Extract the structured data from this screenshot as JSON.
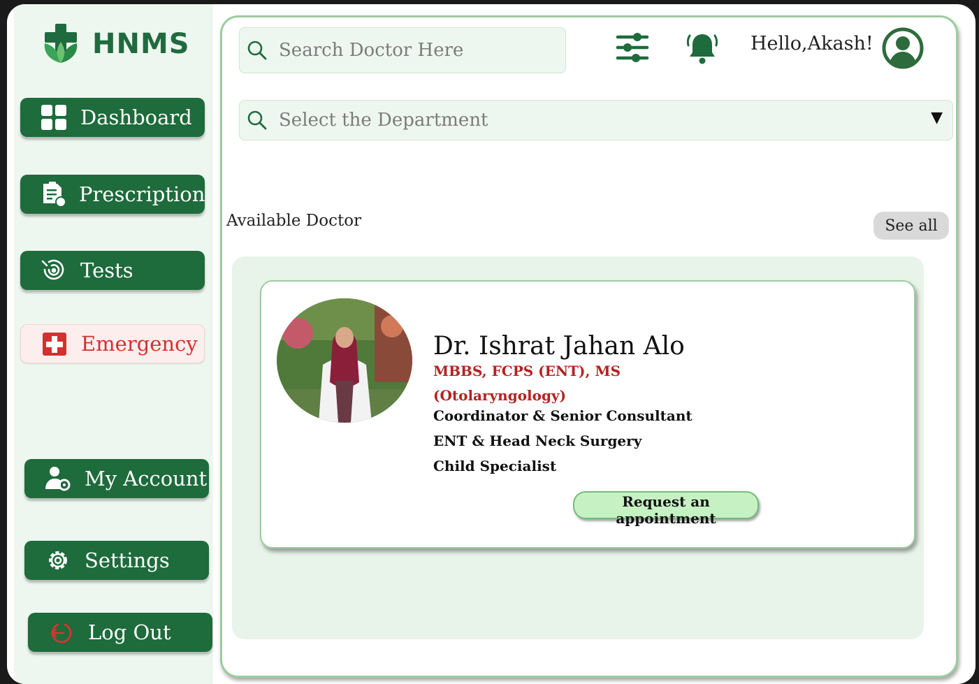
{
  "brand": {
    "name": "HNMS"
  },
  "sidebar": {
    "items": [
      {
        "label": "Dashboard",
        "icon": "grid-icon"
      },
      {
        "label": "Prescription",
        "icon": "prescription-icon"
      },
      {
        "label": "Tests",
        "icon": "tests-icon"
      },
      {
        "label": "Emergency",
        "icon": "emergency-kit-icon"
      },
      {
        "label": "My Account",
        "icon": "user-gear-icon"
      },
      {
        "label": "Settings",
        "icon": "gear-icon"
      },
      {
        "label": "Log Out",
        "icon": "logout-icon"
      }
    ]
  },
  "header": {
    "search_placeholder": "Search Doctor Here",
    "greeting": "Hello,Akash!"
  },
  "department": {
    "placeholder": "Select the Department"
  },
  "available": {
    "title": "Available Doctor",
    "see_all": "See all"
  },
  "doctor": {
    "name": "Dr. Ishrat Jahan Alo",
    "degrees_line1": "MBBS, FCPS (ENT), MS",
    "degrees_line2": "(Otolaryngology)",
    "role": "Coordinator & Senior Consultant",
    "department": "ENT & Head Neck Surgery",
    "specialty": "Child Specialist",
    "button": "Request an appointment"
  },
  "colors": {
    "primary": "#1e6b3c",
    "sidebar_bg": "#eef7ef",
    "emergency": "#d3302f",
    "degree_text": "#b52222",
    "button_bg": "#c6f2c3"
  }
}
